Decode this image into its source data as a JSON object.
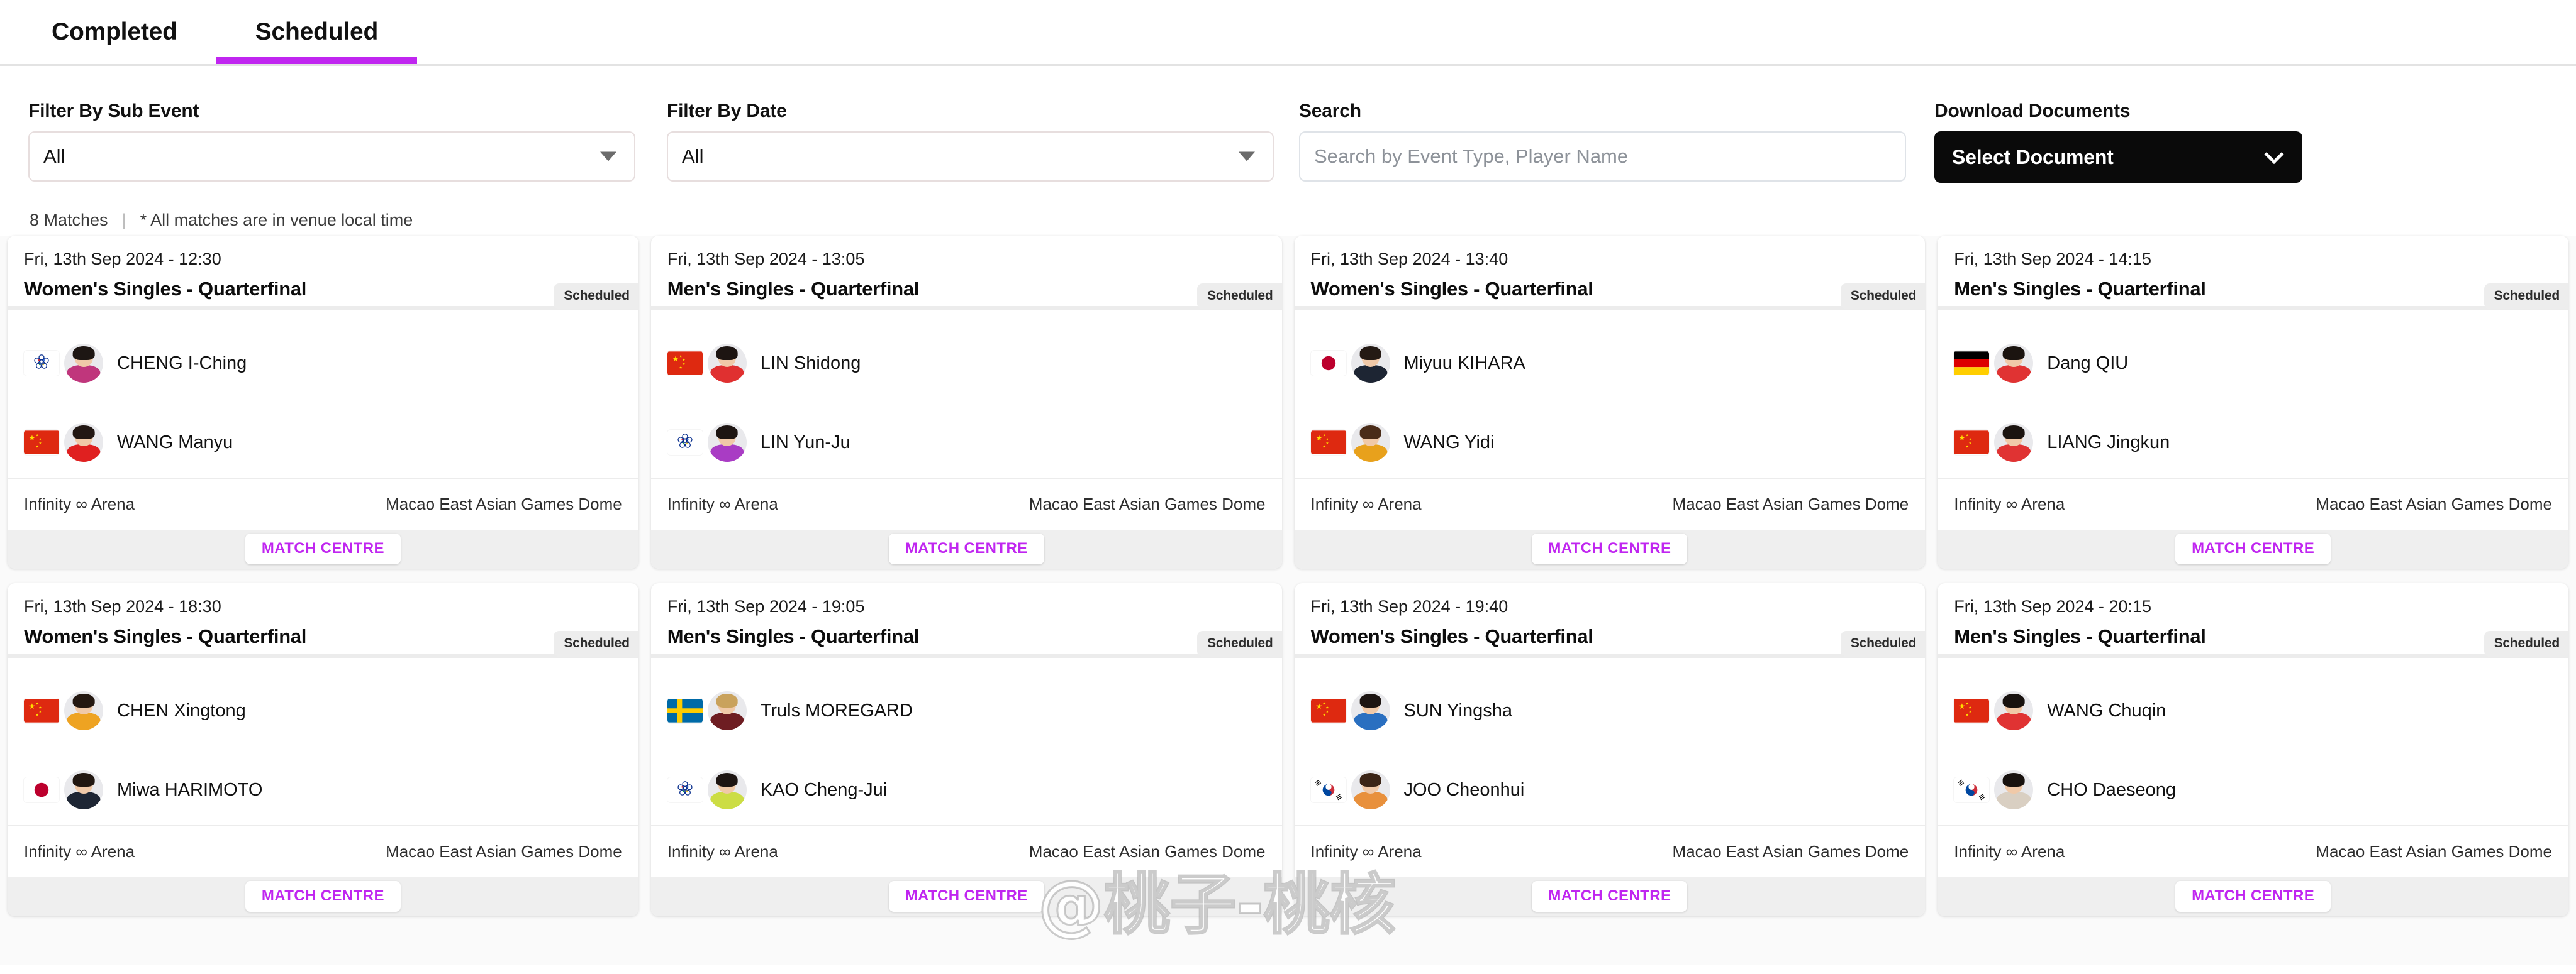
{
  "tabs": [
    {
      "label": "Completed",
      "active": false
    },
    {
      "label": "Scheduled",
      "active": true
    }
  ],
  "filters": {
    "sub_event": {
      "label": "Filter By Sub Event",
      "value": "All"
    },
    "date": {
      "label": "Filter By Date",
      "value": "All"
    },
    "search": {
      "label": "Search",
      "value": "",
      "placeholder": "Search by Event Type, Player Name"
    },
    "download": {
      "label": "Download Documents",
      "value": "Select Document"
    }
  },
  "meta": {
    "count": "8 Matches",
    "separator": "|",
    "note": "* All matches are in venue local time"
  },
  "accent_color": "#c026f0",
  "watermark": "@桃子-桃核",
  "matches": [
    {
      "date": "Fri, 13th Sep 2024 - 12:30",
      "title": "Women's Singles - Quarterfinal",
      "status": "Scheduled",
      "venue": "Infinity ∞ Arena",
      "location": "Macao East Asian Games Dome",
      "button": "MATCH CENTRE",
      "players": [
        {
          "name": "CHENG I-Ching",
          "flag": "chinese-taipei",
          "kit": "#c0367c",
          "hair": "#1d1613"
        },
        {
          "name": "WANG Manyu",
          "flag": "china",
          "kit": "#e02020",
          "hair": "#221713"
        }
      ]
    },
    {
      "date": "Fri, 13th Sep 2024 - 13:05",
      "title": "Men's Singles - Quarterfinal",
      "status": "Scheduled",
      "venue": "Infinity ∞ Arena",
      "location": "Macao East Asian Games Dome",
      "button": "MATCH CENTRE",
      "players": [
        {
          "name": "LIN Shidong",
          "flag": "china",
          "kit": "#e03030",
          "hair": "#1d1512"
        },
        {
          "name": "LIN Yun-Ju",
          "flag": "chinese-taipei",
          "kit": "#a93cc4",
          "hair": "#1d1512"
        }
      ]
    },
    {
      "date": "Fri, 13th Sep 2024 - 13:40",
      "title": "Women's Singles - Quarterfinal",
      "status": "Scheduled",
      "venue": "Infinity ∞ Arena",
      "location": "Macao East Asian Games Dome",
      "button": "MATCH CENTRE",
      "players": [
        {
          "name": "Miyuu KIHARA",
          "flag": "japan",
          "kit": "#1d2533",
          "hair": "#241a14"
        },
        {
          "name": "WANG Yidi",
          "flag": "china",
          "kit": "#e8a11c",
          "hair": "#4a2c18"
        }
      ]
    },
    {
      "date": "Fri, 13th Sep 2024 - 14:15",
      "title": "Men's Singles - Quarterfinal",
      "status": "Scheduled",
      "venue": "Infinity ∞ Arena",
      "location": "Macao East Asian Games Dome",
      "button": "MATCH CENTRE",
      "players": [
        {
          "name": "Dang QIU",
          "flag": "germany",
          "kit": "#e03333",
          "hair": "#1b1410"
        },
        {
          "name": "LIANG Jingkun",
          "flag": "china",
          "kit": "#e03333",
          "hair": "#1b1410"
        }
      ]
    },
    {
      "date": "Fri, 13th Sep 2024 - 18:30",
      "title": "Women's Singles - Quarterfinal",
      "status": "Scheduled",
      "venue": "Infinity ∞ Arena",
      "location": "Macao East Asian Games Dome",
      "button": "MATCH CENTRE",
      "players": [
        {
          "name": "CHEN Xingtong",
          "flag": "china",
          "kit": "#eea322",
          "hair": "#241811"
        },
        {
          "name": "Miwa HARIMOTO",
          "flag": "japan",
          "kit": "#1e2634",
          "hair": "#211711"
        }
      ]
    },
    {
      "date": "Fri, 13th Sep 2024 - 19:05",
      "title": "Men's Singles - Quarterfinal",
      "status": "Scheduled",
      "venue": "Infinity ∞ Arena",
      "location": "Macao East Asian Games Dome",
      "button": "MATCH CENTRE",
      "players": [
        {
          "name": "Truls MOREGARD",
          "flag": "sweden",
          "kit": "#6e1d22",
          "hair": "#c9a25c"
        },
        {
          "name": "KAO Cheng-Jui",
          "flag": "chinese-taipei",
          "kit": "#ccdd44",
          "hair": "#1d1512"
        }
      ]
    },
    {
      "date": "Fri, 13th Sep 2024 - 19:40",
      "title": "Women's Singles - Quarterfinal",
      "status": "Scheduled",
      "venue": "Infinity ∞ Arena",
      "location": "Macao East Asian Games Dome",
      "button": "MATCH CENTRE",
      "players": [
        {
          "name": "SUN Yingsha",
          "flag": "china",
          "kit": "#2a6fc0",
          "hair": "#1d1512"
        },
        {
          "name": "JOO Cheonhui",
          "flag": "south-korea",
          "kit": "#e8903c",
          "hair": "#3b2517"
        }
      ]
    },
    {
      "date": "Fri, 13th Sep 2024 - 20:15",
      "title": "Men's Singles - Quarterfinal",
      "status": "Scheduled",
      "venue": "Infinity ∞ Arena",
      "location": "Macao East Asian Games Dome",
      "button": "MATCH CENTRE",
      "players": [
        {
          "name": "WANG Chuqin",
          "flag": "china",
          "kit": "#e03333",
          "hair": "#18120f"
        },
        {
          "name": "CHO Daeseong",
          "flag": "south-korea",
          "kit": "#d9cfc2",
          "hair": "#18120f"
        }
      ]
    }
  ]
}
